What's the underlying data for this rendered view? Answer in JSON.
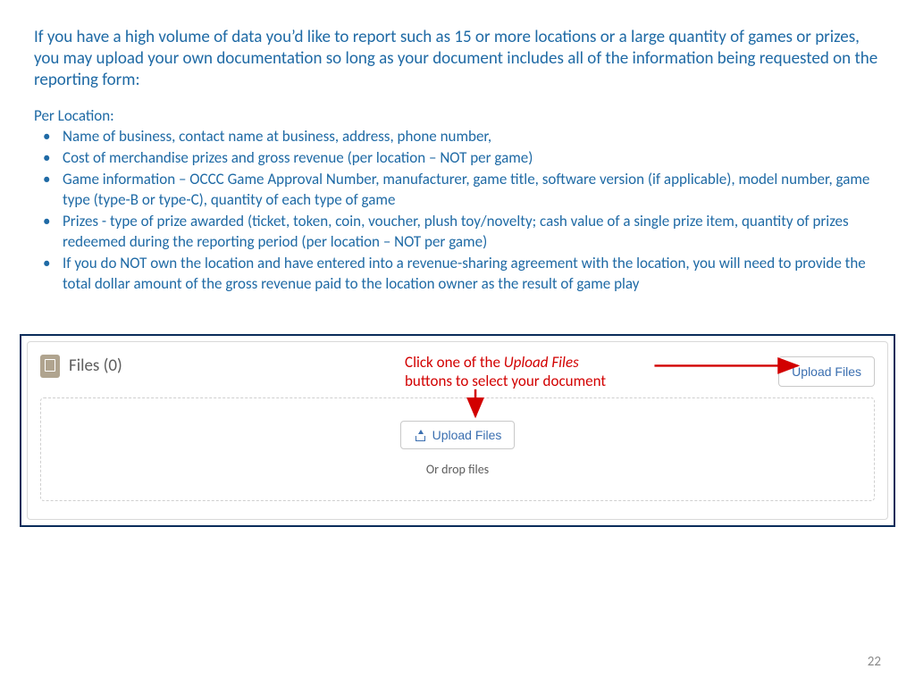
{
  "intro": "If you have a high volume of data you’d like to report such as 15 or more locations or a large quantity of games or prizes, you may upload your own documentation so long as your document includes all of the information being requested on the reporting form:",
  "perLocationLabel": "Per Location:",
  "requirements": [
    "Name of business, contact name at business, address, phone number,",
    "Cost of merchandise prizes and gross revenue (per location – NOT per game)",
    "Game information – OCCC Game Approval Number, manufacturer, game title, software version (if applicable), model number, game type (type-B or type-C), quantity of each type of game",
    "Prizes -  type of prize awarded (ticket, token, coin, voucher, plush toy/novelty; cash value of a single prize item, quantity of prizes redeemed during the reporting period (per location – NOT per game)",
    "If you do NOT own the location and have entered into a revenue-sharing agreement with the location, you will need to provide the total dollar amount of the gross revenue paid to the location owner as the result of game play"
  ],
  "filesPanel": {
    "title": "Files (0)",
    "uploadTop": "Upload Files",
    "uploadCenter": "Upload Files",
    "dropText": "Or drop files"
  },
  "callout": {
    "prefix": "Click one of the ",
    "italic": "Upload Files",
    "suffix": " buttons to select your document"
  },
  "pageNumber": "22"
}
